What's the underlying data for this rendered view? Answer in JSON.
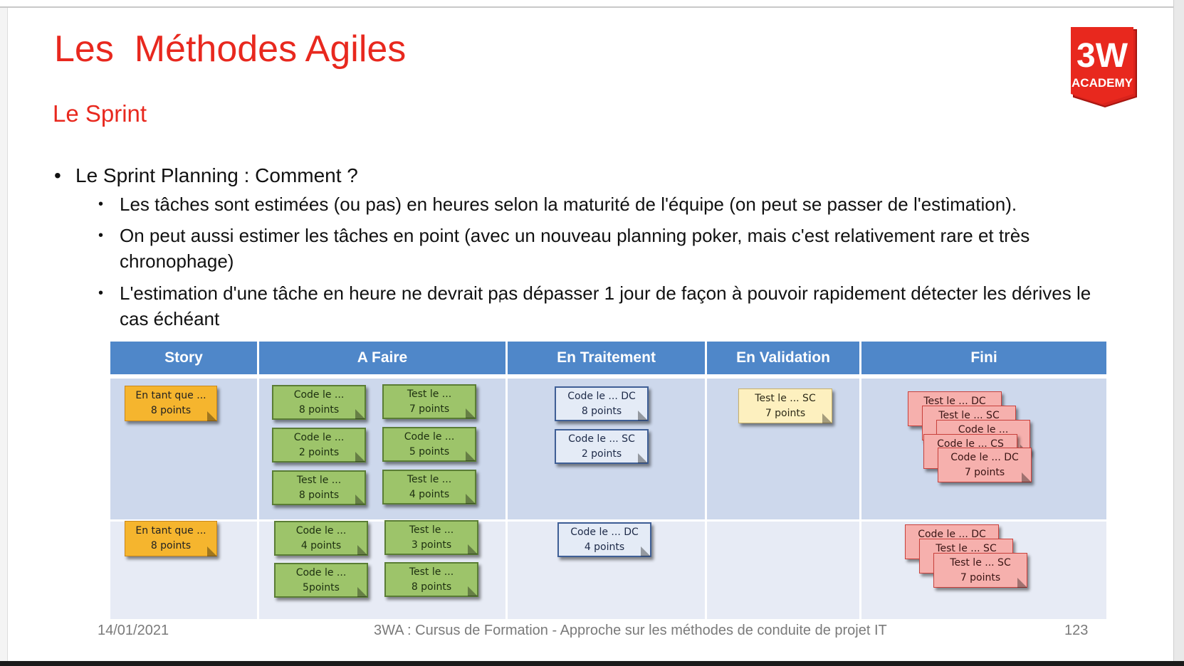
{
  "slide": {
    "title": "Les  Méthodes Agiles",
    "subtitle": "Le Sprint",
    "logo_top": "3W",
    "logo_bottom": "ACADEMY",
    "bullet_main": "Le Sprint Planning : Comment ?",
    "sub_bullets": [
      "Les tâches sont estimées (ou pas) en heures selon la maturité de l'équipe (on peut se passer de l'estimation).",
      "On peut aussi estimer les tâches en point (avec un nouveau planning poker, mais c'est relativement rare et très chronophage)",
      "L'estimation d'une tâche en heure ne devrait pas dépasser 1 jour de façon à pouvoir rapidement détecter les dérives le cas échéant"
    ],
    "bullet_char": "•",
    "colors": {
      "title": "#e8281e",
      "header": "#4f87c9",
      "row1": "#cdd8ec",
      "row2": "#e7ebf5"
    }
  },
  "board": {
    "columns": [
      "Story",
      "A Faire",
      "En Traitement",
      "En Validation",
      "Fini"
    ],
    "notes": {
      "story1": [
        "En tant que ...",
        "8 points"
      ],
      "story2": [
        "En tant que ...",
        "8 points"
      ],
      "af1": [
        "Code le ...",
        "8 points"
      ],
      "af2": [
        "Test le ...",
        "7 points"
      ],
      "af3": [
        "Code le ...",
        "2 points"
      ],
      "af4": [
        "Code le ...",
        "5 points"
      ],
      "af5": [
        "Test le ...",
        "8 points"
      ],
      "af6": [
        "Test le ...",
        "4 points"
      ],
      "af7": [
        "Code le ...",
        "4 points"
      ],
      "af8": [
        "Test le ...",
        "3 points"
      ],
      "af9": [
        "Code le ...",
        "5points"
      ],
      "af10": [
        "Test le ...",
        "8 points"
      ],
      "et1": [
        "Code le ... DC",
        "8 points"
      ],
      "et2": [
        "Code le ... SC",
        "2 points"
      ],
      "et3": [
        "Code le ... DC",
        "4 points"
      ],
      "ev1": [
        "Test le ... SC",
        "7 points"
      ],
      "f1": [
        "Test le ... DC"
      ],
      "f2": [
        "Test le ... SC"
      ],
      "f3": [
        "Code le ..."
      ],
      "f4": [
        "Code le ... CS"
      ],
      "f5": [
        "Code le ... DC",
        "7 points"
      ],
      "f6": [
        "Code le ... DC"
      ],
      "f7": [
        "Test le ... SC"
      ],
      "f8": [
        "Test le ... SC",
        "7 points"
      ]
    }
  },
  "footer": {
    "date": "14/01/2021",
    "course": "3WA : Cursus de Formation - Approche sur les méthodes de conduite de projet IT",
    "page": "123"
  }
}
